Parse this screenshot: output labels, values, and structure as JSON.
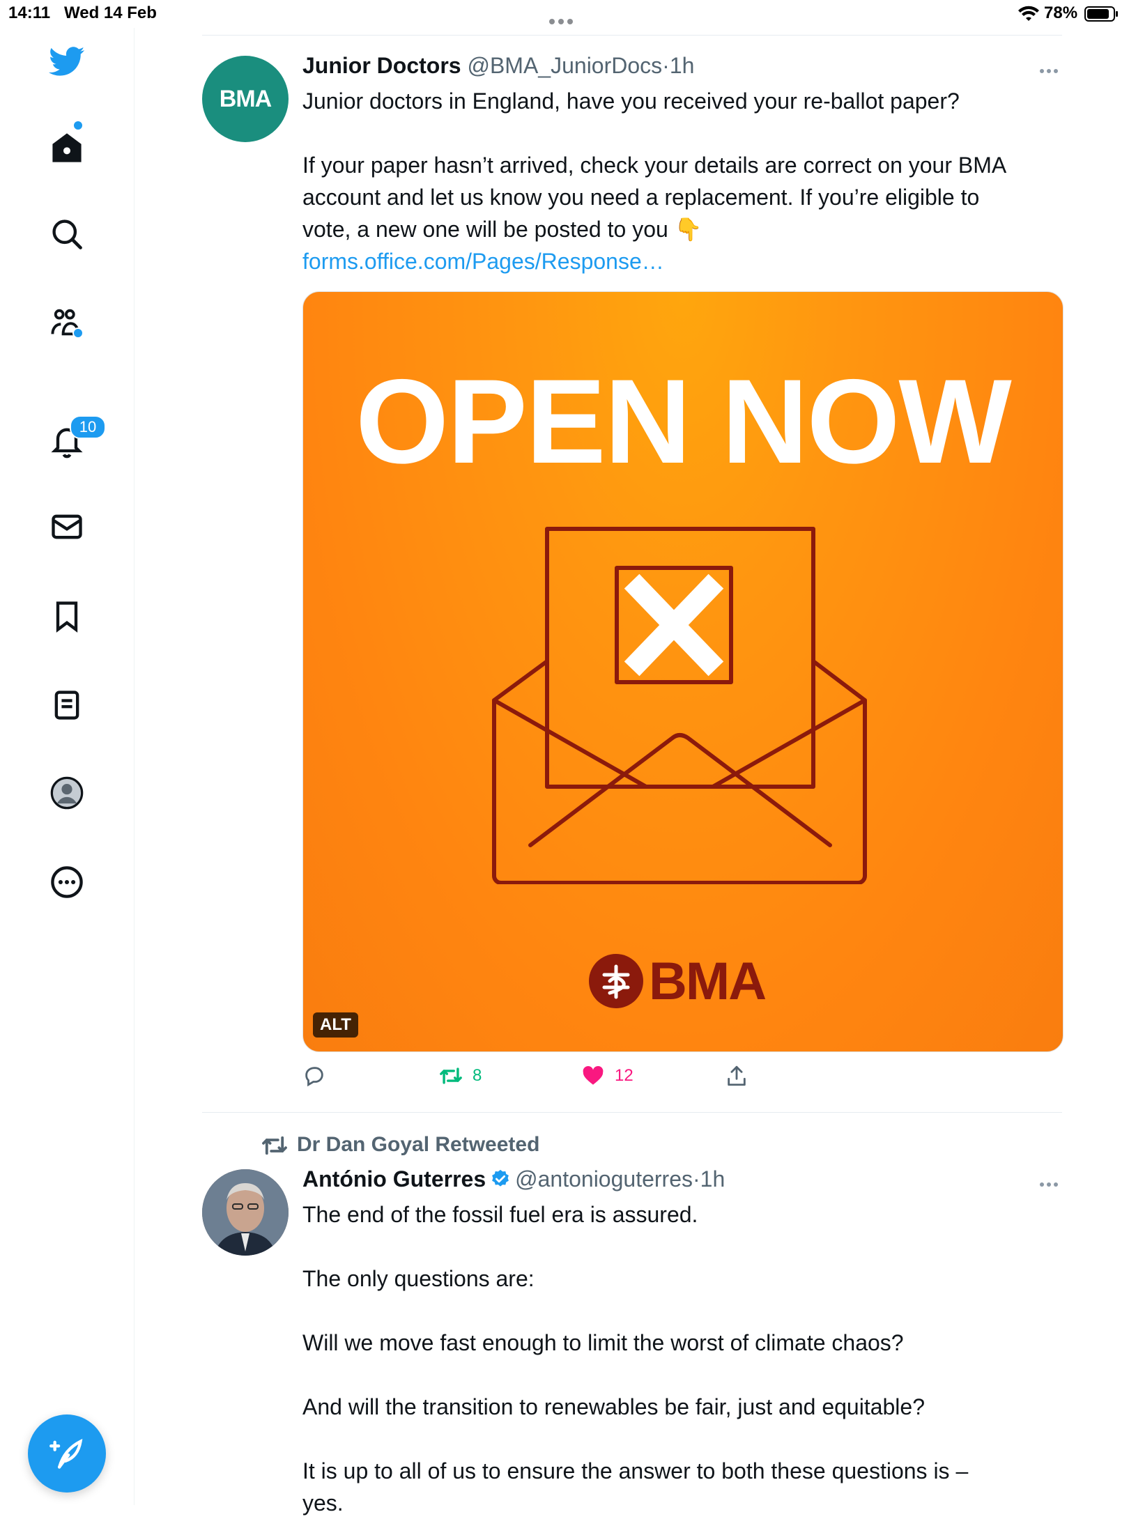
{
  "status_bar": {
    "time": "14:11",
    "date": "Wed 14 Feb",
    "battery": "78%"
  },
  "sidebar": {
    "notifications_count": "10"
  },
  "tweets": [
    {
      "name": "Junior Doctors",
      "handle": "@BMA_JuniorDocs",
      "separator": "·",
      "time": "1h",
      "avatar_text": "BMA",
      "lines": [
        "Junior doctors in England, have you received your re-ballot paper?",
        "",
        "If your paper hasn’t arrived, check your details are correct on your BMA",
        "account and let us know you need a replacement. If you’re eligible to",
        "vote, a new one will be posted to you 👇"
      ],
      "link": "forms.office.com/Pages/Response…",
      "media": {
        "headline": "OPEN NOW",
        "brand": "BMA",
        "alt_label": "ALT"
      },
      "retweets": "8",
      "likes": "12"
    },
    {
      "retweeted_by": "Dr Dan Goyal Retweeted",
      "name": "António Guterres",
      "handle": "@antonioguterres",
      "separator": "·",
      "time": "1h",
      "lines": [
        "The end of the fossil fuel era is assured.",
        "",
        "The only questions are:",
        "",
        "Will we move fast enough to limit the worst of climate chaos?",
        "",
        "And will the transition to renewables be fair, just and equitable?",
        "",
        "It is up to all of us to ensure the answer to both these questions is –",
        "yes."
      ]
    }
  ],
  "colors": {
    "accent": "#1d9bf0",
    "like": "#f91880",
    "retweet": "#00ba7c",
    "bma_teal": "#1a8e7e",
    "banner_orange": "#ff8a10"
  }
}
